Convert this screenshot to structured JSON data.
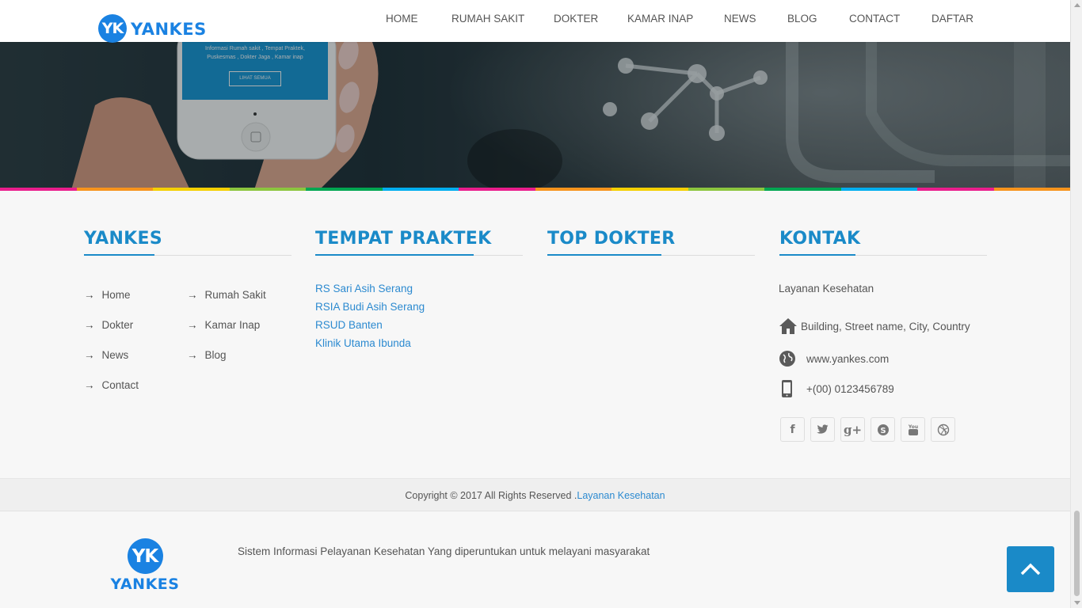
{
  "brand": {
    "badge": "YK",
    "name": "YANKES"
  },
  "nav": [
    "HOME",
    "RUMAH SAKIT",
    "DOKTER",
    "KAMAR INAP",
    "NEWS",
    "BLOG",
    "CONTACT",
    "DAFTAR"
  ],
  "hero": {
    "phone_text": "Informasi Rumah sakit , Tempat Praktek, Puskesmas , Dokter Jaga , Kamar inap",
    "phone_button": "LIHAT SEMUA"
  },
  "stripe_colors": [
    "#e91e8c",
    "#f7941d",
    "#f5d000",
    "#8cc63f",
    "#00a651",
    "#00aeef",
    "#e91e8c",
    "#f7941d",
    "#f5d000",
    "#8cc63f",
    "#00a651",
    "#00aeef",
    "#e91e8c",
    "#f7941d"
  ],
  "footer": {
    "yankes": {
      "title": "YANKES",
      "links": [
        "Home",
        "Rumah Sakit",
        "Dokter",
        "Kamar Inap",
        "News",
        "Blog",
        "Contact"
      ]
    },
    "praktek": {
      "title": "TEMPAT PRAKTEK",
      "links": [
        "RS Sari Asih Serang",
        "RSIA Budi Asih Serang",
        "RSUD Banten",
        "Klinik Utama Ibunda"
      ]
    },
    "top_dokter": {
      "title": "TOP DOKTER"
    },
    "kontak": {
      "title": "KONTAK",
      "subtitle": "Layanan Kesehatan",
      "address": "Building, Street name, City, Country",
      "website": "www.yankes.com",
      "phone": "+(00) 0123456789",
      "social": [
        "facebook-icon",
        "twitter-icon",
        "google-plus-icon",
        "skype-icon",
        "youtube-icon",
        "dribbble-icon"
      ]
    }
  },
  "copyright": {
    "text": "Copyright © 2017 All Rights Reserved .",
    "link": "Layanan Kesehatan"
  },
  "bottom": {
    "description": "Sistem Informasi Pelayanan Kesehatan Yang diperuntukan untuk melayani masyarakat"
  },
  "accent": "#1a8ac8"
}
